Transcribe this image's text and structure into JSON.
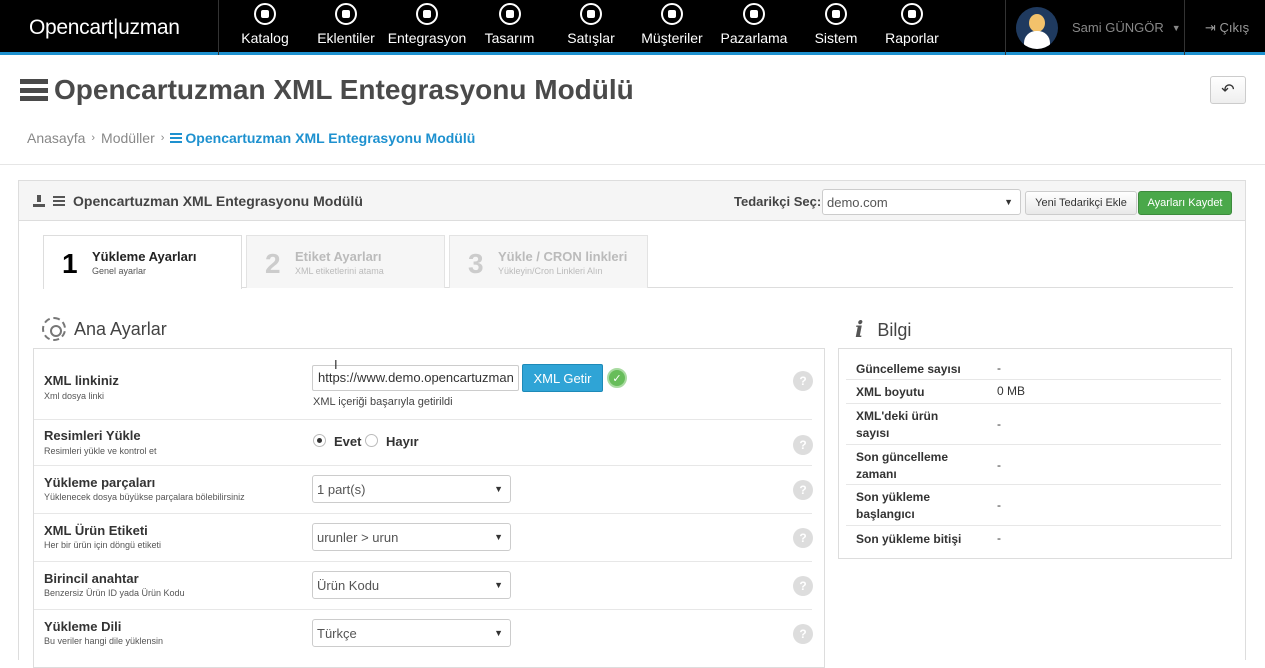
{
  "brand": "Opencart|uzman",
  "nav": [
    {
      "label": "Katalog",
      "icon": "tag-icon"
    },
    {
      "label": "Eklentiler",
      "icon": "puzzle-icon"
    },
    {
      "label": "Entegrasyon",
      "icon": "download-icon"
    },
    {
      "label": "Tasarım",
      "icon": "monitor-icon"
    },
    {
      "label": "Satışlar",
      "icon": "cart-icon"
    },
    {
      "label": "Müşteriler",
      "icon": "user-icon"
    },
    {
      "label": "Pazarlama",
      "icon": "share-icon"
    },
    {
      "label": "Sistem",
      "icon": "gear-icon"
    },
    {
      "label": "Raporlar",
      "icon": "bar-chart-icon"
    }
  ],
  "user": {
    "name": "Sami GÜNGÖR"
  },
  "logout_label": "Çıkış",
  "page": {
    "title": "Opencartuzman XML Entegrasyonu Modülü",
    "breadcrumb": [
      "Anasayfa",
      "Modüller",
      "Opencartuzman XML Entegrasyonu Modülü"
    ]
  },
  "panel": {
    "title": "Opencartuzman XML Entegrasyonu Modülü",
    "supplier_label": "Tedarikçi Seç:",
    "supplier_value": "demo.com",
    "add_supplier_label": "Yeni Tedarikçi Ekle",
    "save_label": "Ayarları Kaydet"
  },
  "steps": [
    {
      "num": "1",
      "title": "Yükleme Ayarları",
      "sub": "Genel ayarlar",
      "active": true
    },
    {
      "num": "2",
      "title": "Etiket Ayarları",
      "sub": "XML etiketlerini atama",
      "active": false
    },
    {
      "num": "3",
      "title": "Yükle / CRON linkleri",
      "sub": "Yükleyin/Cron Linkleri Alın",
      "active": false
    }
  ],
  "main_settings": {
    "title": "Ana Ayarlar",
    "xml_link": {
      "label": "XML linkiniz",
      "sub": "Xml dosya linki",
      "value": "https://www.demo.opencartuzman",
      "button": "XML Getir",
      "success": "XML içeriği başarıyla getirildi"
    },
    "images": {
      "label": "Resimleri Yükle",
      "sub": "Resimleri yükle ve kontrol et",
      "yes": "Evet",
      "no": "Hayır",
      "selected": "yes"
    },
    "parts": {
      "label": "Yükleme parçaları",
      "sub": "Yüklenecek dosya büyükse parçalara bölebilirsiniz",
      "value": "1 part(s)"
    },
    "product_tag": {
      "label": "XML Ürün Etiketi",
      "sub": "Her bir ürün için döngü etiketi",
      "value": "urunler > urun"
    },
    "primary_key": {
      "label": "Birincil anahtar",
      "sub": "Benzersiz Ürün ID yada Ürün Kodu",
      "value": "Ürün Kodu"
    },
    "language": {
      "label": "Yükleme Dili",
      "sub": "Bu veriler hangi dile yüklensin",
      "value": "Türkçe"
    }
  },
  "info": {
    "title": "Bilgi",
    "rows": [
      {
        "key": "Güncelleme sayısı",
        "value": "-"
      },
      {
        "key": "XML boyutu",
        "value": "0 MB"
      },
      {
        "key": "XML'deki ürün sayısı",
        "value": "-"
      },
      {
        "key": "Son güncelleme zamanı",
        "value": "-"
      },
      {
        "key": "Son yükleme başlangıcı",
        "value": "-"
      },
      {
        "key": "Son yükleme bitişi",
        "value": "-"
      }
    ]
  },
  "colors": {
    "accent": "#1e91cf",
    "success": "#4aa84a",
    "info_button": "#2fa4d6"
  }
}
